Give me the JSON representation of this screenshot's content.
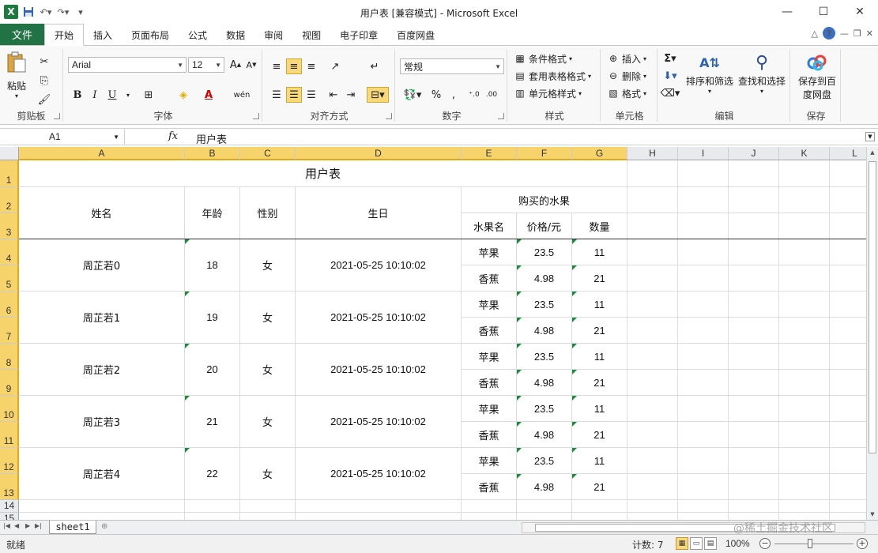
{
  "titlebar": {
    "title": "用户表  [兼容模式]  -  Microsoft Excel",
    "logo": "X"
  },
  "ribbon_tabs": {
    "file": "文件",
    "items": [
      "开始",
      "插入",
      "页面布局",
      "公式",
      "数据",
      "审阅",
      "视图",
      "电子印章",
      "百度网盘"
    ],
    "active_index": 0
  },
  "ribbon": {
    "clipboard": {
      "label": "剪贴板",
      "paste": "粘贴"
    },
    "font": {
      "label": "字体",
      "family": "Arial",
      "size": "12",
      "bold": "B",
      "italic": "I",
      "underline": "U"
    },
    "alignment": {
      "label": "对齐方式"
    },
    "number": {
      "label": "数字",
      "format": "常规",
      "percent": "%"
    },
    "styles": {
      "label": "样式",
      "conditional": "条件格式",
      "table": "套用表格格式",
      "cell": "单元格样式"
    },
    "cells": {
      "label": "单元格",
      "insert": "插入",
      "delete": "删除",
      "format": "格式"
    },
    "editing": {
      "label": "编辑",
      "sort": "排序和筛选",
      "find": "查找和选择"
    },
    "save": {
      "label": "保存",
      "button": "保存到百度网盘",
      "button_line1": "保存到百",
      "button_line2": "度网盘"
    }
  },
  "formula_bar": {
    "name_box": "A1",
    "fx": "fx",
    "content": "用户表"
  },
  "sheet": {
    "columns": [
      "A",
      "B",
      "C",
      "D",
      "E",
      "F",
      "G",
      "H",
      "I",
      "J",
      "K",
      "L"
    ],
    "rows": [
      "1",
      "2",
      "3",
      "4",
      "5",
      "6",
      "7",
      "8",
      "9",
      "10",
      "11",
      "12",
      "13",
      "14",
      "15"
    ],
    "title": "用户表",
    "headers": {
      "name": "姓名",
      "age": "年龄",
      "gender": "性别",
      "birthday": "生日",
      "fruit_group": "购买的水果",
      "fruit_name": "水果名",
      "price": "价格/元",
      "qty": "数量"
    },
    "records": [
      {
        "name": "周芷若0",
        "age": "18",
        "gender": "女",
        "birthday": "2021-05-25 10:10:02",
        "fruits": [
          {
            "name": "苹果",
            "price": "23.5",
            "qty": "11"
          },
          {
            "name": "香蕉",
            "price": "4.98",
            "qty": "21"
          }
        ]
      },
      {
        "name": "周芷若1",
        "age": "19",
        "gender": "女",
        "birthday": "2021-05-25 10:10:02",
        "fruits": [
          {
            "name": "苹果",
            "price": "23.5",
            "qty": "11"
          },
          {
            "name": "香蕉",
            "price": "4.98",
            "qty": "21"
          }
        ]
      },
      {
        "name": "周芷若2",
        "age": "20",
        "gender": "女",
        "birthday": "2021-05-25 10:10:02",
        "fruits": [
          {
            "name": "苹果",
            "price": "23.5",
            "qty": "11"
          },
          {
            "name": "香蕉",
            "price": "4.98",
            "qty": "21"
          }
        ]
      },
      {
        "name": "周芷若3",
        "age": "21",
        "gender": "女",
        "birthday": "2021-05-25 10:10:02",
        "fruits": [
          {
            "name": "苹果",
            "price": "23.5",
            "qty": "11"
          },
          {
            "name": "香蕉",
            "price": "4.98",
            "qty": "21"
          }
        ]
      },
      {
        "name": "周芷若4",
        "age": "22",
        "gender": "女",
        "birthday": "2021-05-25 10:10:02",
        "fruits": [
          {
            "name": "苹果",
            "price": "23.5",
            "qty": "11"
          },
          {
            "name": "香蕉",
            "price": "4.98",
            "qty": "21"
          }
        ]
      }
    ]
  },
  "sheetbar": {
    "tab": "sheet1"
  },
  "statusbar": {
    "ready": "就绪",
    "count": "计数: 7",
    "zoom": "100%"
  },
  "watermark": "@稀土掘金技术社区",
  "colors": {
    "excel_green": "#217346",
    "selection": "#f6d36b",
    "error_triangle": "#1a8c3a"
  }
}
